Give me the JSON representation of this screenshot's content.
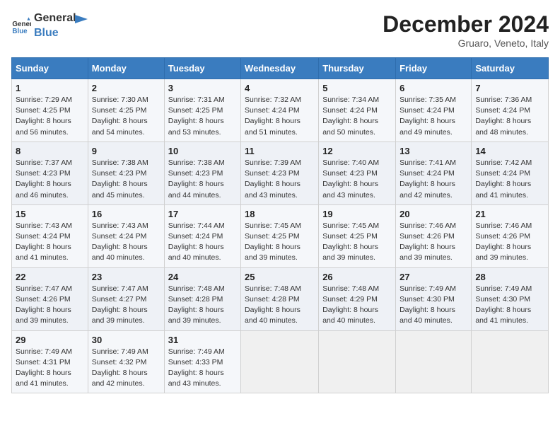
{
  "header": {
    "title": "December 2024",
    "subtitle": "Gruaro, Veneto, Italy",
    "logo_line1": "General",
    "logo_line2": "Blue"
  },
  "days_of_week": [
    "Sunday",
    "Monday",
    "Tuesday",
    "Wednesday",
    "Thursday",
    "Friday",
    "Saturday"
  ],
  "weeks": [
    [
      {
        "day": "1",
        "sunrise": "7:29 AM",
        "sunset": "4:25 PM",
        "daylight": "8 hours and 56 minutes."
      },
      {
        "day": "2",
        "sunrise": "7:30 AM",
        "sunset": "4:25 PM",
        "daylight": "8 hours and 54 minutes."
      },
      {
        "day": "3",
        "sunrise": "7:31 AM",
        "sunset": "4:25 PM",
        "daylight": "8 hours and 53 minutes."
      },
      {
        "day": "4",
        "sunrise": "7:32 AM",
        "sunset": "4:24 PM",
        "daylight": "8 hours and 51 minutes."
      },
      {
        "day": "5",
        "sunrise": "7:34 AM",
        "sunset": "4:24 PM",
        "daylight": "8 hours and 50 minutes."
      },
      {
        "day": "6",
        "sunrise": "7:35 AM",
        "sunset": "4:24 PM",
        "daylight": "8 hours and 49 minutes."
      },
      {
        "day": "7",
        "sunrise": "7:36 AM",
        "sunset": "4:24 PM",
        "daylight": "8 hours and 48 minutes."
      }
    ],
    [
      {
        "day": "8",
        "sunrise": "7:37 AM",
        "sunset": "4:23 PM",
        "daylight": "8 hours and 46 minutes."
      },
      {
        "day": "9",
        "sunrise": "7:38 AM",
        "sunset": "4:23 PM",
        "daylight": "8 hours and 45 minutes."
      },
      {
        "day": "10",
        "sunrise": "7:38 AM",
        "sunset": "4:23 PM",
        "daylight": "8 hours and 44 minutes."
      },
      {
        "day": "11",
        "sunrise": "7:39 AM",
        "sunset": "4:23 PM",
        "daylight": "8 hours and 43 minutes."
      },
      {
        "day": "12",
        "sunrise": "7:40 AM",
        "sunset": "4:23 PM",
        "daylight": "8 hours and 43 minutes."
      },
      {
        "day": "13",
        "sunrise": "7:41 AM",
        "sunset": "4:24 PM",
        "daylight": "8 hours and 42 minutes."
      },
      {
        "day": "14",
        "sunrise": "7:42 AM",
        "sunset": "4:24 PM",
        "daylight": "8 hours and 41 minutes."
      }
    ],
    [
      {
        "day": "15",
        "sunrise": "7:43 AM",
        "sunset": "4:24 PM",
        "daylight": "8 hours and 41 minutes."
      },
      {
        "day": "16",
        "sunrise": "7:43 AM",
        "sunset": "4:24 PM",
        "daylight": "8 hours and 40 minutes."
      },
      {
        "day": "17",
        "sunrise": "7:44 AM",
        "sunset": "4:24 PM",
        "daylight": "8 hours and 40 minutes."
      },
      {
        "day": "18",
        "sunrise": "7:45 AM",
        "sunset": "4:25 PM",
        "daylight": "8 hours and 39 minutes."
      },
      {
        "day": "19",
        "sunrise": "7:45 AM",
        "sunset": "4:25 PM",
        "daylight": "8 hours and 39 minutes."
      },
      {
        "day": "20",
        "sunrise": "7:46 AM",
        "sunset": "4:26 PM",
        "daylight": "8 hours and 39 minutes."
      },
      {
        "day": "21",
        "sunrise": "7:46 AM",
        "sunset": "4:26 PM",
        "daylight": "8 hours and 39 minutes."
      }
    ],
    [
      {
        "day": "22",
        "sunrise": "7:47 AM",
        "sunset": "4:26 PM",
        "daylight": "8 hours and 39 minutes."
      },
      {
        "day": "23",
        "sunrise": "7:47 AM",
        "sunset": "4:27 PM",
        "daylight": "8 hours and 39 minutes."
      },
      {
        "day": "24",
        "sunrise": "7:48 AM",
        "sunset": "4:28 PM",
        "daylight": "8 hours and 39 minutes."
      },
      {
        "day": "25",
        "sunrise": "7:48 AM",
        "sunset": "4:28 PM",
        "daylight": "8 hours and 40 minutes."
      },
      {
        "day": "26",
        "sunrise": "7:48 AM",
        "sunset": "4:29 PM",
        "daylight": "8 hours and 40 minutes."
      },
      {
        "day": "27",
        "sunrise": "7:49 AM",
        "sunset": "4:30 PM",
        "daylight": "8 hours and 40 minutes."
      },
      {
        "day": "28",
        "sunrise": "7:49 AM",
        "sunset": "4:30 PM",
        "daylight": "8 hours and 41 minutes."
      }
    ],
    [
      {
        "day": "29",
        "sunrise": "7:49 AM",
        "sunset": "4:31 PM",
        "daylight": "8 hours and 41 minutes."
      },
      {
        "day": "30",
        "sunrise": "7:49 AM",
        "sunset": "4:32 PM",
        "daylight": "8 hours and 42 minutes."
      },
      {
        "day": "31",
        "sunrise": "7:49 AM",
        "sunset": "4:33 PM",
        "daylight": "8 hours and 43 minutes."
      },
      null,
      null,
      null,
      null
    ]
  ],
  "labels": {
    "sunrise": "Sunrise:",
    "sunset": "Sunset:",
    "daylight": "Daylight:"
  }
}
